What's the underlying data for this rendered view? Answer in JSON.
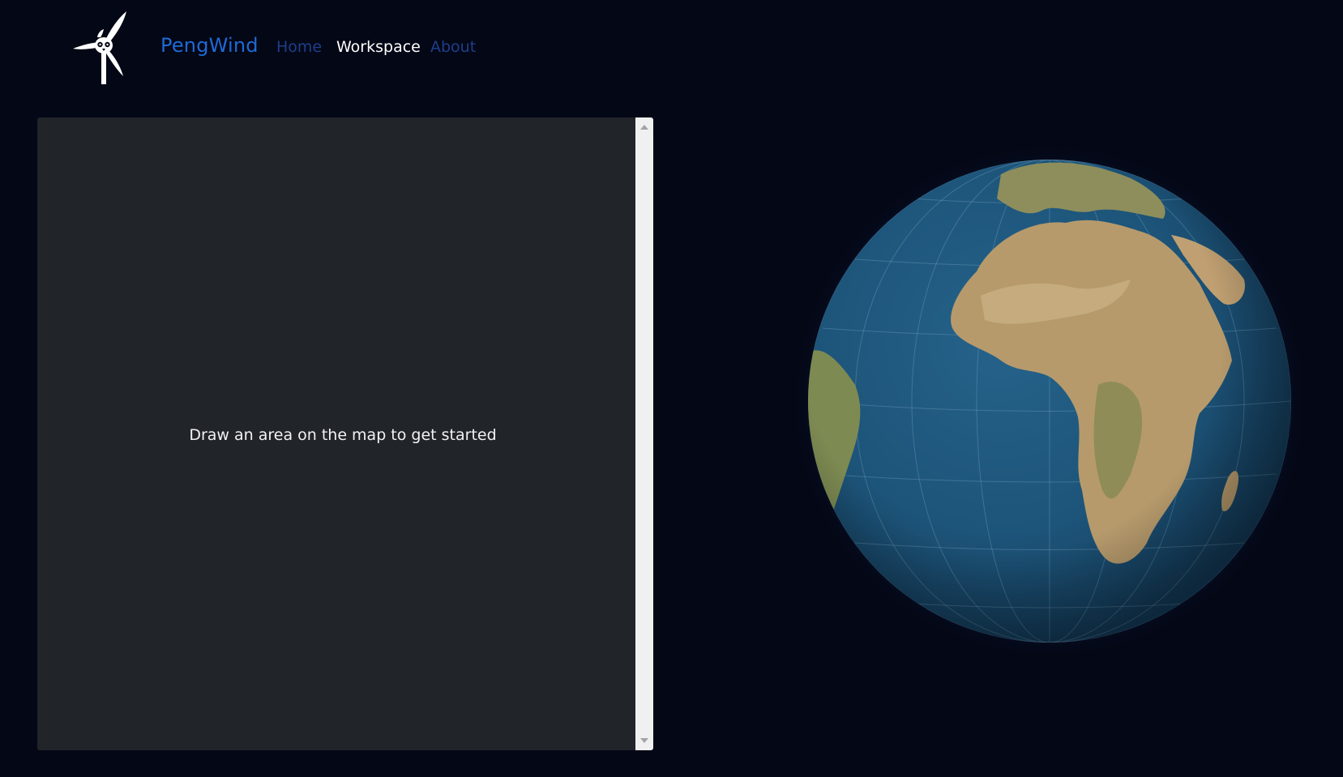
{
  "app": {
    "brand": "PengWind"
  },
  "nav": {
    "home": "Home",
    "workspace": "Workspace",
    "about": "About",
    "active": "Workspace"
  },
  "panel": {
    "placeholder": "Draw an area on the map to get started"
  },
  "colors": {
    "background": "#040716",
    "brand": "#1e6ad6",
    "nav_inactive": "#1d3f8a",
    "nav_active": "#ffffff",
    "panel": "#212429",
    "ocean": "#1d5479",
    "land": "#b69a6c"
  },
  "icons": {
    "logo": "wind-turbine-penguin-icon",
    "scroll_up": "arrow-up-icon",
    "scroll_down": "arrow-down-icon"
  }
}
